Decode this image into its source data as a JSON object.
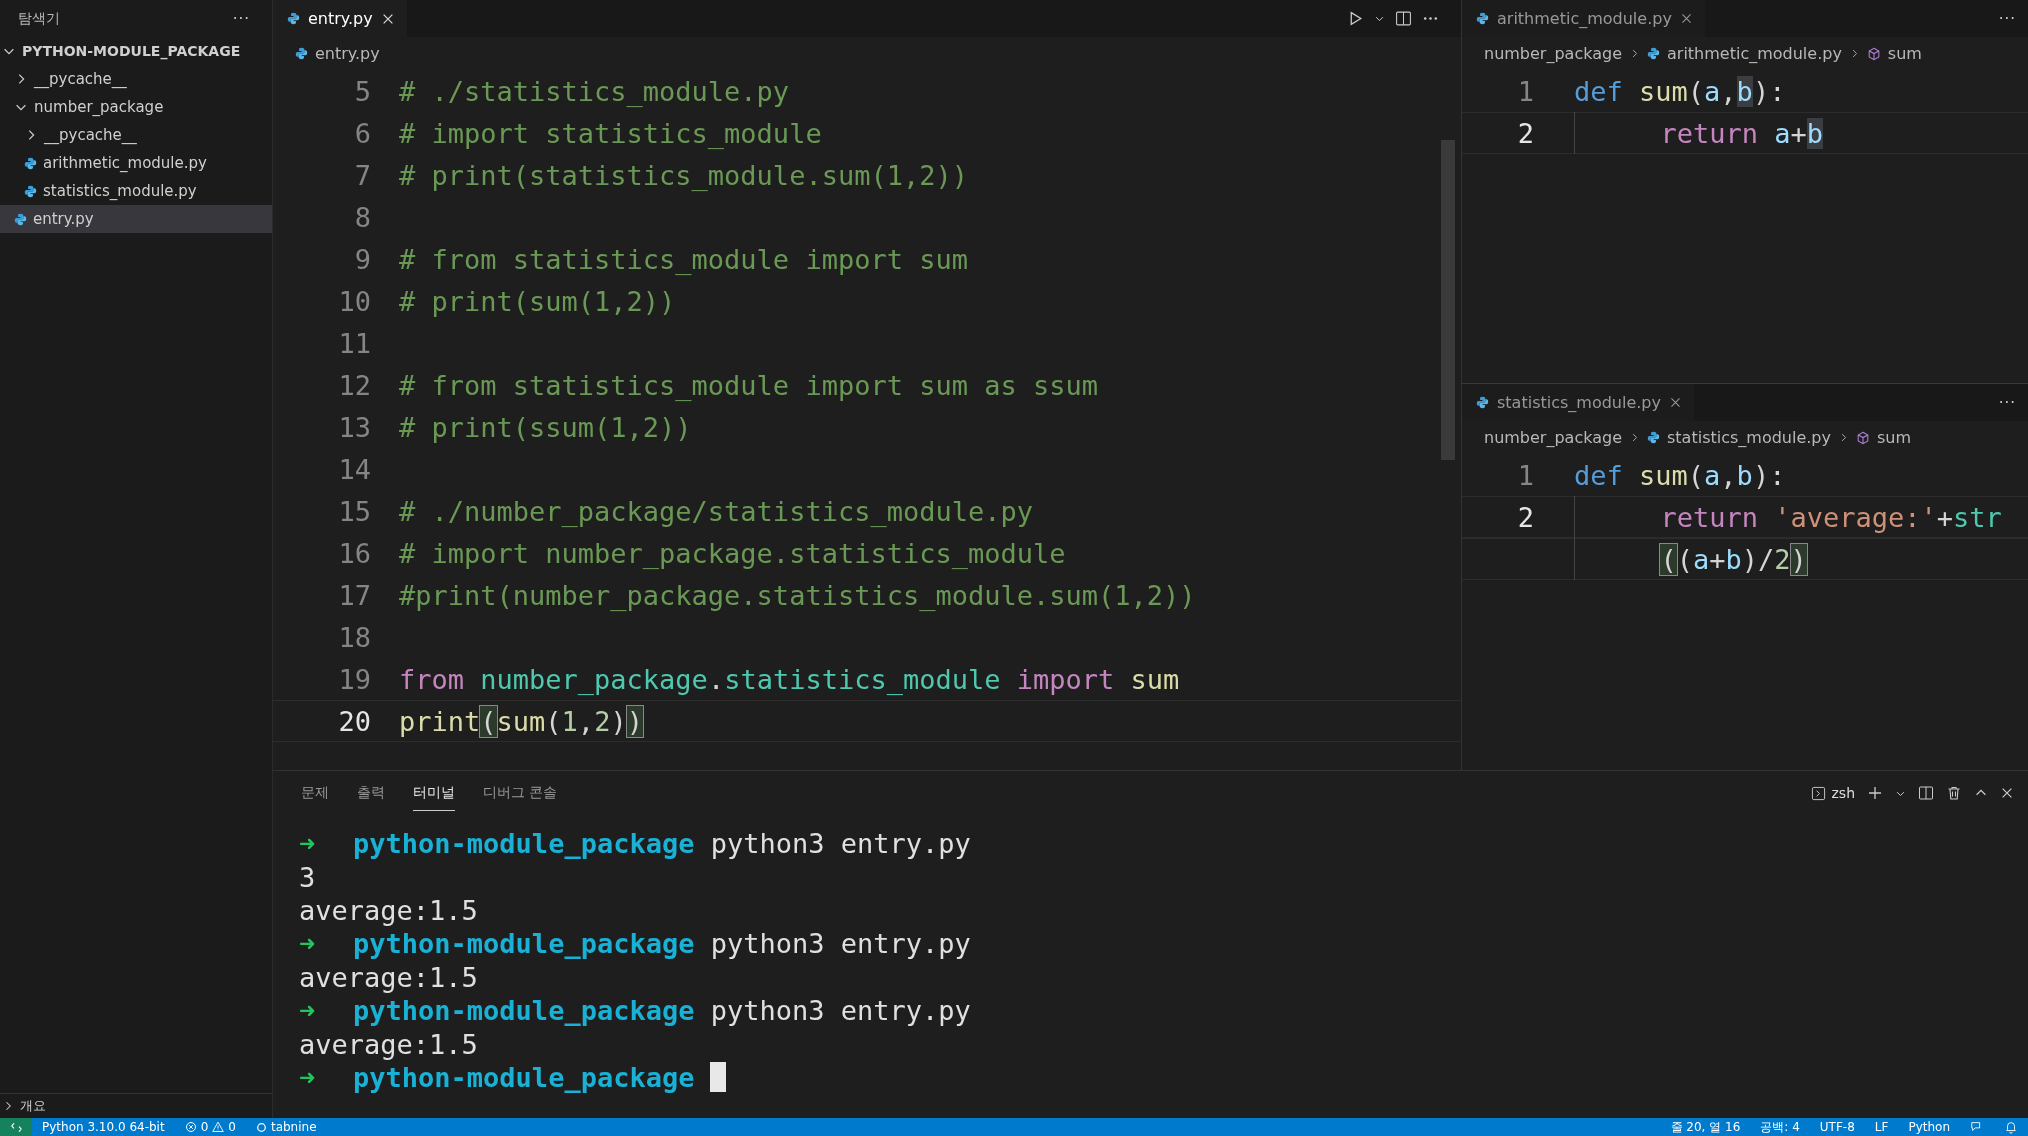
{
  "sidebar": {
    "title": "탐색기",
    "more": "···",
    "root": {
      "label": "PYTHON-MODULE_PACKAGE",
      "expanded": true,
      "children": [
        {
          "label": "__pycache__",
          "kind": "folder",
          "expanded": false,
          "selected": false
        },
        {
          "label": "number_package",
          "kind": "folder",
          "expanded": true,
          "selected": false,
          "children": [
            {
              "label": "__pycache__",
              "kind": "folder",
              "expanded": false,
              "selected": false
            },
            {
              "label": "arithmetic_module.py",
              "kind": "file",
              "selected": false
            },
            {
              "label": "statistics_module.py",
              "kind": "file",
              "selected": false
            }
          ]
        },
        {
          "label": "entry.py",
          "kind": "file",
          "selected": true
        }
      ]
    },
    "outline": {
      "label": "개요",
      "expanded": false
    }
  },
  "main_editor": {
    "tabs": [
      {
        "label": "entry.py",
        "selected": true
      }
    ],
    "breadcrumb": [
      "entry.py"
    ],
    "lines": [
      {
        "number": "5",
        "current": false,
        "tokens": [
          {
            "kind": "comment",
            "text": "# ./statistics_module.py"
          }
        ]
      },
      {
        "number": "6",
        "current": false,
        "tokens": [
          {
            "kind": "comment",
            "text": "# import statistics_module"
          }
        ]
      },
      {
        "number": "7",
        "current": false,
        "tokens": [
          {
            "kind": "comment",
            "text": "# print(statistics_module.sum(1,2))"
          }
        ]
      },
      {
        "number": "8",
        "current": false
      },
      {
        "number": "9",
        "current": false,
        "tokens": [
          {
            "kind": "comment",
            "text": "# from statistics_module import sum"
          }
        ]
      },
      {
        "number": "10",
        "current": false,
        "tokens": [
          {
            "kind": "comment",
            "text": "# print(sum(1,2))"
          }
        ]
      },
      {
        "number": "11",
        "current": false
      },
      {
        "number": "12",
        "current": false,
        "tokens": [
          {
            "kind": "comment",
            "text": "# from statistics_module import sum as ssum"
          }
        ]
      },
      {
        "number": "13",
        "current": false,
        "tokens": [
          {
            "kind": "comment",
            "text": "# print(ssum(1,2))"
          }
        ]
      },
      {
        "number": "14",
        "current": false
      },
      {
        "number": "15",
        "current": false,
        "tokens": [
          {
            "kind": "comment",
            "text": "# ./number_package/statistics_module.py"
          }
        ]
      },
      {
        "number": "16",
        "current": false,
        "tokens": [
          {
            "kind": "comment",
            "text": "# import number_package.statistics_module"
          }
        ]
      },
      {
        "number": "17",
        "current": false,
        "tokens": [
          {
            "kind": "comment",
            "text": "#print(number_package.statistics_module.sum(1,2))"
          }
        ]
      },
      {
        "number": "18",
        "current": false
      },
      {
        "number": "19",
        "current": false,
        "tokens": [
          {
            "kind": "keyword",
            "text": "from"
          },
          {
            "kind": "module",
            "text": " number_package"
          },
          {
            "kind": "plain",
            "text": "."
          },
          {
            "kind": "module",
            "text": "statistics_module"
          },
          {
            "kind": "keyword",
            "text": " import"
          },
          {
            "kind": "func",
            "text": " sum"
          }
        ]
      },
      {
        "number": "20",
        "current": true,
        "tokens": [
          {
            "kind": "func",
            "text": "print"
          },
          {
            "kind": "bracket-match",
            "text": "("
          },
          {
            "kind": "func",
            "text": "sum"
          },
          {
            "kind": "plain",
            "text": "("
          },
          {
            "kind": "number",
            "text": "1"
          },
          {
            "kind": "plain",
            "text": ","
          },
          {
            "kind": "number",
            "text": "2"
          },
          {
            "kind": "plain",
            "text": ")"
          },
          {
            "kind": "bracket-match",
            "text": ")"
          }
        ]
      }
    ]
  },
  "side_editors": [
    {
      "tabs": [
        {
          "label": "arithmetic_module.py",
          "selected": false
        }
      ],
      "more": "···",
      "breadcrumb": {
        "folder": "number_package",
        "file": "arithmetic_module.py",
        "symbol": "sum"
      },
      "lines": [
        {
          "number": "1",
          "current": false,
          "indented": false,
          "tokens": [
            {
              "kind": "def",
              "text": "def"
            },
            {
              "kind": "func",
              "text": " sum"
            },
            {
              "kind": "plain",
              "text": "("
            },
            {
              "kind": "var",
              "text": "a"
            },
            {
              "kind": "plain",
              "text": ","
            },
            {
              "kind": "var-highlight",
              "text": "b"
            },
            {
              "kind": "plain",
              "text": "):"
            }
          ]
        },
        {
          "number": "2",
          "current": true,
          "indented": true,
          "tokens": [
            {
              "kind": "keyword",
              "text": "return"
            },
            {
              "kind": "var",
              "text": " a"
            },
            {
              "kind": "plain",
              "text": "+"
            },
            {
              "kind": "var-highlight",
              "text": "b"
            }
          ]
        }
      ]
    },
    {
      "tabs": [
        {
          "label": "statistics_module.py",
          "selected": false
        }
      ],
      "more": "···",
      "breadcrumb": {
        "folder": "number_package",
        "file": "statistics_module.py",
        "symbol": "sum"
      },
      "lines": [
        {
          "number": "1",
          "current": false,
          "indented": false,
          "tokens": [
            {
              "kind": "def",
              "text": "def"
            },
            {
              "kind": "func",
              "text": " sum"
            },
            {
              "kind": "plain",
              "text": "("
            },
            {
              "kind": "var",
              "text": "a"
            },
            {
              "kind": "plain",
              "text": ","
            },
            {
              "kind": "var",
              "text": "b"
            },
            {
              "kind": "plain",
              "text": "):"
            }
          ]
        },
        {
          "number": "2",
          "current": true,
          "indented": true,
          "tokens": [
            {
              "kind": "keyword",
              "text": "return"
            },
            {
              "kind": "string",
              "text": " 'average:'"
            },
            {
              "kind": "plain",
              "text": "+"
            },
            {
              "kind": "module",
              "text": "str"
            }
          ]
        },
        {
          "current": true,
          "indented": true,
          "tokens": [
            {
              "kind": "bracket-match",
              "text": "("
            },
            {
              "kind": "plain",
              "text": "("
            },
            {
              "kind": "var",
              "text": "a"
            },
            {
              "kind": "plain",
              "text": "+"
            },
            {
              "kind": "var",
              "text": "b"
            },
            {
              "kind": "plain",
              "text": ")/"
            },
            {
              "kind": "number",
              "text": "2"
            },
            {
              "kind": "bracket-match",
              "text": ")"
            }
          ]
        }
      ]
    }
  ],
  "panel": {
    "tabs": [
      {
        "label": "문제",
        "selected": false
      },
      {
        "label": "출력",
        "selected": false
      },
      {
        "label": "터미널",
        "selected": true
      },
      {
        "label": "디버그 콘솔",
        "selected": false
      }
    ],
    "shell": "zsh",
    "terminal": [
      {
        "kind": "prompt",
        "arrow": "➜",
        "dir": "python-module_package",
        "command": "python3 entry.py",
        "cursor": false
      },
      {
        "kind": "output",
        "text": "3"
      },
      {
        "kind": "output",
        "text": "average:1.5"
      },
      {
        "kind": "prompt",
        "arrow": "➜",
        "dir": "python-module_package",
        "command": "python3 entry.py",
        "cursor": false
      },
      {
        "kind": "output",
        "text": "average:1.5"
      },
      {
        "kind": "prompt",
        "arrow": "➜",
        "dir": "python-module_package",
        "command": "python3 entry.py",
        "cursor": false
      },
      {
        "kind": "output",
        "text": "average:1.5"
      },
      {
        "kind": "prompt",
        "arrow": "➜",
        "dir": "python-module_package",
        "cursor": true
      }
    ]
  },
  "status_bar": {
    "interpreter": "Python 3.10.0 64-bit",
    "errors": "0",
    "warnings": "0",
    "extension": "tabnine",
    "position": "줄 20, 열 16",
    "indent": "공백: 4",
    "encoding": "UTF-8",
    "eol": "LF",
    "language": "Python"
  }
}
